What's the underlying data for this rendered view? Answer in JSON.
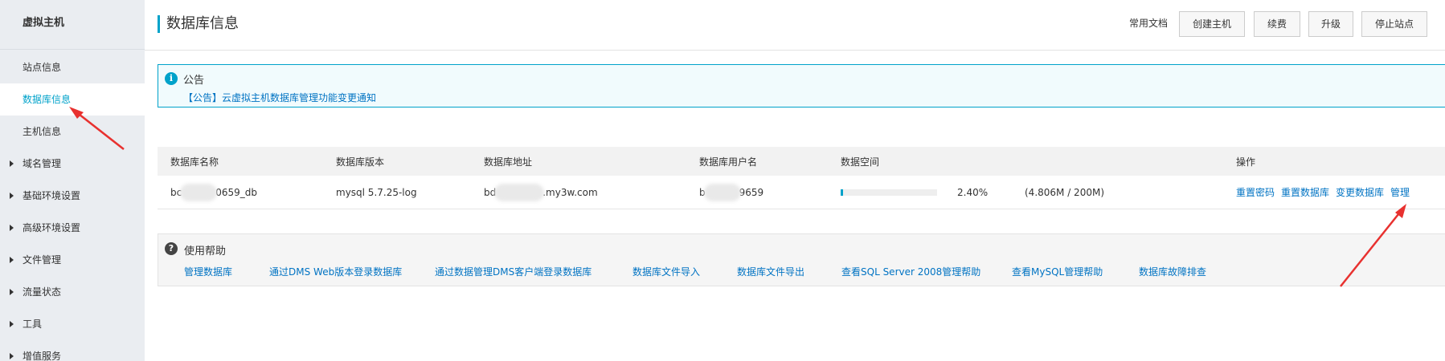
{
  "sidebar": {
    "title": "虚拟主机",
    "items": [
      {
        "label": "站点信息"
      },
      {
        "label": "数据库信息"
      },
      {
        "label": "主机信息"
      },
      {
        "label": "域名管理"
      },
      {
        "label": "基础环境设置"
      },
      {
        "label": "高级环境设置"
      },
      {
        "label": "文件管理"
      },
      {
        "label": "流量状态"
      },
      {
        "label": "工具"
      },
      {
        "label": "增值服务"
      }
    ],
    "active_item": "数据库信息"
  },
  "header": {
    "title": "数据库信息",
    "doc_link": "常用文档",
    "buttons": {
      "create": "创建主机",
      "renew": "续费",
      "upgrade": "升级",
      "stop": "停止站点"
    }
  },
  "notice": {
    "title": "公告",
    "link": "【公告】云虚拟主机数据库管理功能变更通知",
    "icon": "info-icon"
  },
  "table": {
    "headers": {
      "name": "数据库名称",
      "version": "数据库版本",
      "address": "数据库地址",
      "username": "数据库用户名",
      "space": "数据空间",
      "ops": "操作"
    },
    "row": {
      "name_prefix": "bc",
      "name_suffix": "0659_db",
      "version": "mysql 5.7.25-log",
      "address_prefix": "bd",
      "address_suffix": ".my3w.com",
      "user_prefix": "b",
      "user_suffix": "9659",
      "space_percent": "2.40%",
      "space_fraction": 0.024,
      "space_usage": "(4.806M / 200M)",
      "ops": {
        "reset_password": "重置密码",
        "reset_db": "重置数据库",
        "change_db": "变更数据库",
        "manage": "管理"
      }
    }
  },
  "help": {
    "title": "使用帮助",
    "links": [
      "管理数据库",
      "通过DMS Web版本登录数据库",
      "通过数据管理DMS客户端登录数据库",
      "数据库文件导入",
      "数据库文件导出",
      "查看SQL Server 2008管理帮助",
      "查看MySQL管理帮助",
      "数据库故障排查"
    ]
  },
  "colors": {
    "accent": "#00a2ca",
    "link": "#0073c3",
    "annotation_arrow": "#e8312f"
  }
}
